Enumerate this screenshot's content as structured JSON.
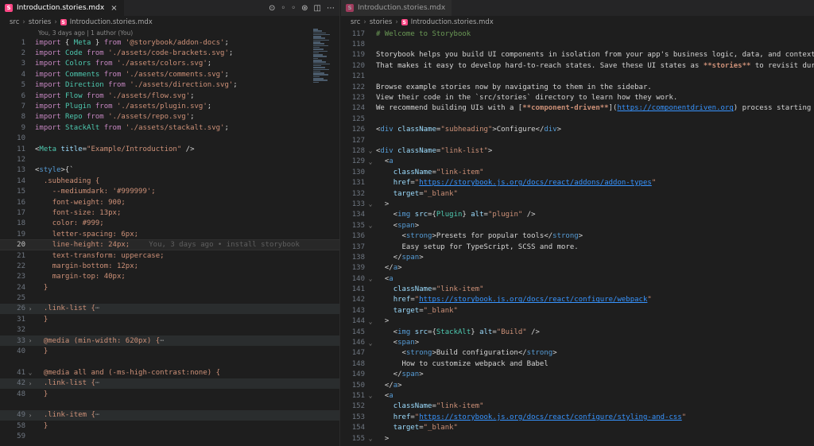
{
  "left": {
    "tab_label": "Introduction.stories.mdx",
    "tab_icon": "S",
    "breadcrumb": [
      "src",
      "stories",
      "Introduction.stories.mdx"
    ],
    "codelens": "You, 3 days ago | 1 author (You)",
    "blame": "You, 3 days ago • install storybook",
    "lines": [
      {
        "n": "1",
        "html": "<span class='k'>import</span> { <span class='v'>Meta</span> } <span class='k'>from</span> <span class='s'>'@storybook/addon-docs'</span>;"
      },
      {
        "n": "2",
        "html": "<span class='k'>import</span> <span class='v'>Code</span> <span class='k'>from</span> <span class='s'>'./assets/code-brackets.svg'</span>;"
      },
      {
        "n": "3",
        "html": "<span class='k'>import</span> <span class='v'>Colors</span> <span class='k'>from</span> <span class='s'>'./assets/colors.svg'</span>;"
      },
      {
        "n": "4",
        "html": "<span class='k'>import</span> <span class='v'>Comments</span> <span class='k'>from</span> <span class='s'>'./assets/comments.svg'</span>;"
      },
      {
        "n": "5",
        "html": "<span class='k'>import</span> <span class='v'>Direction</span> <span class='k'>from</span> <span class='s'>'./assets/direction.svg'</span>;"
      },
      {
        "n": "6",
        "html": "<span class='k'>import</span> <span class='v'>Flow</span> <span class='k'>from</span> <span class='s'>'./assets/flow.svg'</span>;"
      },
      {
        "n": "7",
        "html": "<span class='k'>import</span> <span class='v'>Plugin</span> <span class='k'>from</span> <span class='s'>'./assets/plugin.svg'</span>;"
      },
      {
        "n": "8",
        "html": "<span class='k'>import</span> <span class='v'>Repo</span> <span class='k'>from</span> <span class='s'>'./assets/repo.svg'</span>;"
      },
      {
        "n": "9",
        "html": "<span class='k'>import</span> <span class='v'>StackAlt</span> <span class='k'>from</span> <span class='s'>'./assets/stackalt.svg'</span>;"
      },
      {
        "n": "10",
        "html": ""
      },
      {
        "n": "11",
        "html": "&lt;<span class='v'>Meta</span> <span class='a'>title</span>=<span class='s'>\"Example/Introduction\"</span> /&gt;"
      },
      {
        "n": "12",
        "html": ""
      },
      {
        "n": "13",
        "html": "&lt;<span class='t'>style</span>&gt;{`"
      },
      {
        "n": "14",
        "html": "  <span class='s'>.subheading {</span>"
      },
      {
        "n": "15",
        "html": "    <span class='s'>--mediumdark: '#999999';</span>"
      },
      {
        "n": "16",
        "html": "    <span class='s'>font-weight: 900;</span>"
      },
      {
        "n": "17",
        "html": "    <span class='s'>font-size: 13px;</span>"
      },
      {
        "n": "18",
        "html": "    <span class='s'>color: #999;</span>"
      },
      {
        "n": "19",
        "html": "    <span class='s'>letter-spacing: 6px;</span>"
      },
      {
        "n": "20",
        "html": "    <span class='s'>line-height: 24px;</span>",
        "cursor": true
      },
      {
        "n": "21",
        "html": "    <span class='s'>text-transform: uppercase;</span>"
      },
      {
        "n": "22",
        "html": "    <span class='s'>margin-bottom: 12px;</span>"
      },
      {
        "n": "23",
        "html": "    <span class='s'>margin-top: 40px;</span>"
      },
      {
        "n": "24",
        "html": "  <span class='s'>}</span>"
      },
      {
        "n": "25",
        "html": ""
      },
      {
        "n": "26",
        "html": "  <span class='s'>.link-list {</span><span style='color:#888'>⋯</span>",
        "fold": "›",
        "hl": true
      },
      {
        "n": "31",
        "html": "  <span class='s'>}</span>"
      },
      {
        "n": "32",
        "html": ""
      },
      {
        "n": "33",
        "html": "  <span class='s'>@media (min-width: 620px) {</span><span style='color:#888'>⋯</span>",
        "fold": "›",
        "hl": true
      },
      {
        "n": "40",
        "html": "  <span class='s'>}</span>"
      },
      {
        "n": "",
        "html": ""
      },
      {
        "n": "41",
        "html": "  <span class='s'>@media all and (-ms-high-contrast:none) {</span>",
        "fold": "⌄"
      },
      {
        "n": "42",
        "html": "  <span class='s'>.link-list {</span><span style='color:#888'>⋯</span>",
        "fold": "›",
        "hl": true
      },
      {
        "n": "48",
        "html": "  <span class='s'>}</span>"
      },
      {
        "n": "",
        "html": ""
      },
      {
        "n": "49",
        "html": "  <span class='s'>.link-item {</span><span style='color:#888'>⋯</span>",
        "fold": "›",
        "hl": true
      },
      {
        "n": "58",
        "html": "  <span class='s'>}</span>"
      },
      {
        "n": "59",
        "html": ""
      }
    ]
  },
  "right": {
    "tab_label": "Introduction.stories.mdx",
    "tab_icon": "S",
    "breadcrumb": [
      "src",
      "stories",
      "Introduction.stories.mdx"
    ],
    "lines": [
      {
        "n": "117",
        "html": "<span class='md'># Welcome to Storybook</span>"
      },
      {
        "n": "118",
        "html": ""
      },
      {
        "n": "119",
        "html": "Storybook helps you build UI components in isolation from your app's business logic, data, and context."
      },
      {
        "n": "120",
        "html": "That makes it easy to develop hard-to-reach states. Save these UI states as <span class='bold'>**stories**</span> to revisit during development."
      },
      {
        "n": "121",
        "html": ""
      },
      {
        "n": "122",
        "html": "Browse example stories now by navigating to them in the sidebar."
      },
      {
        "n": "123",
        "html": "View their code in the `src/stories` directory to learn how they work."
      },
      {
        "n": "124",
        "html": "We recommend building UIs with a [<span class='bold'>**component-driven**</span>](<span class='lk'>https://componentdriven.org</span>) process starting with atomic components."
      },
      {
        "n": "125",
        "html": ""
      },
      {
        "n": "126",
        "html": "&lt;<span class='t'>div</span> <span class='a'>className</span>=<span class='s'>\"subheading\"</span>&gt;Configure&lt;/<span class='t'>div</span>&gt;"
      },
      {
        "n": "127",
        "html": ""
      },
      {
        "n": "128",
        "html": "&lt;<span class='t'>div</span> <span class='a'>className</span>=<span class='s'>\"link-list\"</span>&gt;",
        "fold": "⌄"
      },
      {
        "n": "129",
        "html": "  &lt;<span class='t'>a</span>",
        "fold": "⌄"
      },
      {
        "n": "130",
        "html": "    <span class='a'>className</span>=<span class='s'>\"link-item\"</span>"
      },
      {
        "n": "131",
        "html": "    <span class='a'>href</span>=<span class='s'>\"</span><span class='lk'>https://storybook.js.org/docs/react/addons/addon-types</span><span class='s'>\"</span>"
      },
      {
        "n": "132",
        "html": "    <span class='a'>target</span>=<span class='s'>\"_blank\"</span>"
      },
      {
        "n": "133",
        "html": "  &gt;",
        "fold": "⌄"
      },
      {
        "n": "134",
        "html": "    &lt;<span class='t'>img</span> <span class='a'>src</span>={<span class='v'>Plugin</span>} <span class='a'>alt</span>=<span class='s'>\"plugin\"</span> /&gt;"
      },
      {
        "n": "135",
        "html": "    &lt;<span class='t'>span</span>&gt;",
        "fold": "⌄"
      },
      {
        "n": "136",
        "html": "      &lt;<span class='t'>strong</span>&gt;Presets for popular tools&lt;/<span class='t'>strong</span>&gt;"
      },
      {
        "n": "137",
        "html": "      Easy setup for TypeScript, SCSS and more."
      },
      {
        "n": "138",
        "html": "    &lt;/<span class='t'>span</span>&gt;"
      },
      {
        "n": "139",
        "html": "  &lt;/<span class='t'>a</span>&gt;"
      },
      {
        "n": "140",
        "html": "  &lt;<span class='t'>a</span>",
        "fold": "⌄"
      },
      {
        "n": "141",
        "html": "    <span class='a'>className</span>=<span class='s'>\"link-item\"</span>"
      },
      {
        "n": "142",
        "html": "    <span class='a'>href</span>=<span class='s'>\"</span><span class='lk'>https://storybook.js.org/docs/react/configure/webpack</span><span class='s'>\"</span>"
      },
      {
        "n": "143",
        "html": "    <span class='a'>target</span>=<span class='s'>\"_blank\"</span>"
      },
      {
        "n": "144",
        "html": "  &gt;",
        "fold": "⌄"
      },
      {
        "n": "145",
        "html": "    &lt;<span class='t'>img</span> <span class='a'>src</span>={<span class='v'>StackAlt</span>} <span class='a'>alt</span>=<span class='s'>\"Build\"</span> /&gt;"
      },
      {
        "n": "146",
        "html": "    &lt;<span class='t'>span</span>&gt;",
        "fold": "⌄"
      },
      {
        "n": "147",
        "html": "      &lt;<span class='t'>strong</span>&gt;Build configuration&lt;/<span class='t'>strong</span>&gt;"
      },
      {
        "n": "148",
        "html": "      How to customize webpack and Babel"
      },
      {
        "n": "149",
        "html": "    &lt;/<span class='t'>span</span>&gt;"
      },
      {
        "n": "150",
        "html": "  &lt;/<span class='t'>a</span>&gt;"
      },
      {
        "n": "151",
        "html": "  &lt;<span class='t'>a</span>",
        "fold": "⌄"
      },
      {
        "n": "152",
        "html": "    <span class='a'>className</span>=<span class='s'>\"link-item\"</span>"
      },
      {
        "n": "153",
        "html": "    <span class='a'>href</span>=<span class='s'>\"</span><span class='lk'>https://storybook.js.org/docs/react/configure/styling-and-css</span><span class='s'>\"</span>"
      },
      {
        "n": "154",
        "html": "    <span class='a'>target</span>=<span class='s'>\"_blank\"</span>"
      },
      {
        "n": "155",
        "html": "  &gt;",
        "fold": "⌄"
      }
    ]
  }
}
